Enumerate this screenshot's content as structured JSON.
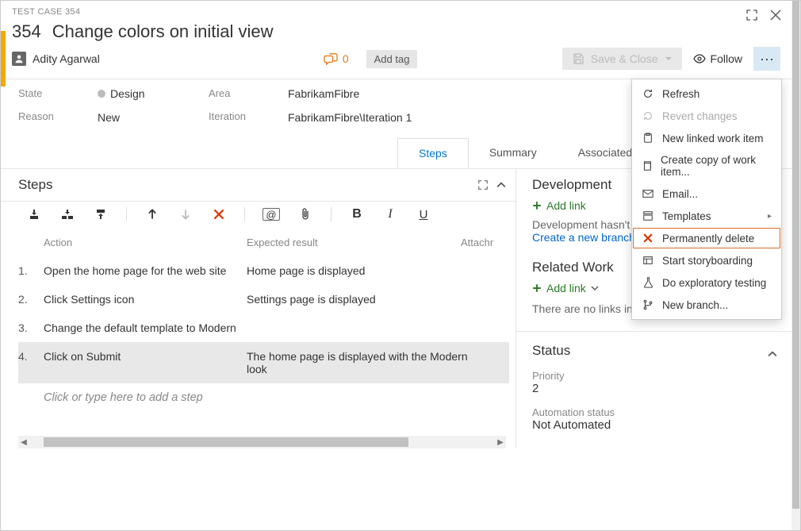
{
  "header": {
    "type_label": "TEST CASE 354",
    "id": "354",
    "title": "Change colors on initial view"
  },
  "assignee": {
    "name": "Adity Agarwal",
    "comment_count": "0"
  },
  "buttons": {
    "add_tag": "Add tag",
    "save_close": "Save & Close",
    "follow": "Follow"
  },
  "fields": {
    "state_label": "State",
    "state_value": "Design",
    "reason_label": "Reason",
    "reason_value": "New",
    "area_label": "Area",
    "area_value": "FabrikamFibre",
    "iteration_label": "Iteration",
    "iteration_value": "FabrikamFibre\\Iteration 1"
  },
  "tabs": {
    "steps": "Steps",
    "summary": "Summary",
    "associated": "Associated Automation"
  },
  "steps_section": {
    "title": "Steps",
    "col_action": "Action",
    "col_expected": "Expected result",
    "col_attach": "Attachr",
    "rows": [
      {
        "num": "1.",
        "action": "Open the home page for the web site",
        "expected": "Home page is displayed"
      },
      {
        "num": "2.",
        "action": "Click Settings icon",
        "expected": "Settings page is displayed"
      },
      {
        "num": "3.",
        "action": "Change the default template to Modern",
        "expected": ""
      },
      {
        "num": "4.",
        "action": "Click on Submit",
        "expected": "The home page is displayed with the Modern look"
      }
    ],
    "placeholder": "Click or type here to add a step"
  },
  "development": {
    "title": "Development",
    "add_link": "Add link",
    "text": "Development hasn't starte",
    "create_branch": "Create a new branch"
  },
  "related": {
    "title": "Related Work",
    "add_link": "Add link",
    "empty": "There are no links in this group."
  },
  "status": {
    "title": "Status",
    "priority_label": "Priority",
    "priority_value": "2",
    "automation_label": "Automation status",
    "automation_value": "Not Automated"
  },
  "ctx": {
    "refresh": "Refresh",
    "revert": "Revert changes",
    "new_linked": "New linked work item",
    "copy": "Create copy of work item...",
    "email": "Email...",
    "templates": "Templates",
    "perm_delete": "Permanently delete",
    "storyboard": "Start storyboarding",
    "exploratory": "Do exploratory testing",
    "new_branch": "New branch..."
  }
}
